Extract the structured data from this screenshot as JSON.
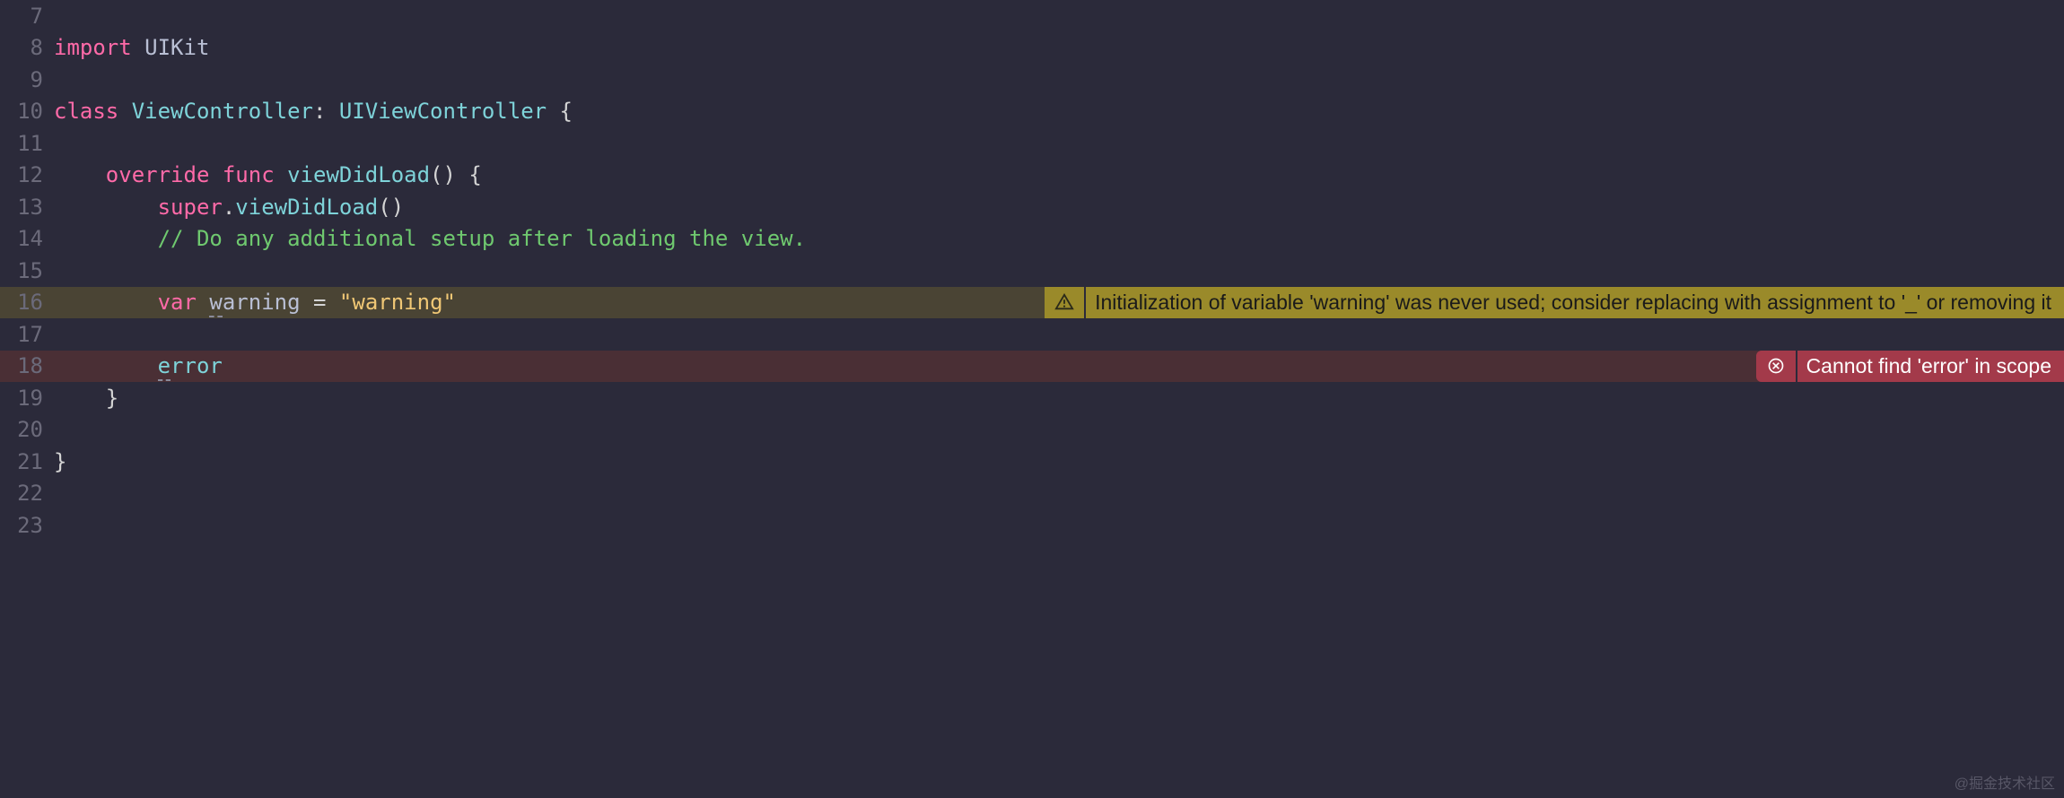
{
  "lines": {
    "7": {
      "num": "7"
    },
    "8": {
      "num": "8",
      "import_kw": "import",
      "module": "UIKit"
    },
    "9": {
      "num": "9"
    },
    "10": {
      "num": "10",
      "class_kw": "class",
      "class_name": "ViewController",
      "colon": ":",
      "super_type": "UIViewController",
      "brace": "{"
    },
    "11": {
      "num": "11"
    },
    "12": {
      "num": "12",
      "override_kw": "override",
      "func_kw": "func",
      "method": "viewDidLoad",
      "parens": "()",
      "brace": "{"
    },
    "13": {
      "num": "13",
      "super_kw": "super",
      "dot": ".",
      "method": "viewDidLoad",
      "parens": "()"
    },
    "14": {
      "num": "14",
      "comment": "// Do any additional setup after loading the view."
    },
    "15": {
      "num": "15"
    },
    "16": {
      "num": "16",
      "var_kw": "var",
      "first_char": "w",
      "rest": "arning",
      "eq": " = ",
      "string": "\"warning\""
    },
    "17": {
      "num": "17"
    },
    "18": {
      "num": "18",
      "first_char": "e",
      "rest": "rror"
    },
    "19": {
      "num": "19",
      "brace": "}"
    },
    "20": {
      "num": "20"
    },
    "21": {
      "num": "21",
      "brace": "}"
    },
    "22": {
      "num": "22"
    },
    "23": {
      "num": "23"
    }
  },
  "diagnostics": {
    "warning": {
      "message": "Initialization of variable 'warning' was never used; consider replacing with assignment to '_' or removing it"
    },
    "error": {
      "message": "Cannot find 'error' in scope"
    }
  },
  "watermark": "@掘金技术社区"
}
